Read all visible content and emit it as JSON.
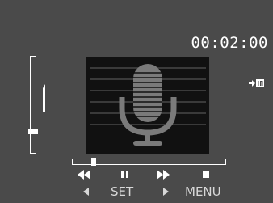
{
  "timer": {
    "elapsed": "00:02:00"
  },
  "volume": {
    "level": 0.22
  },
  "progress": {
    "fraction": 0.12
  },
  "controls": {
    "rewind_icon": "rewind-icon",
    "pause_icon": "pause-icon",
    "fast_forward_icon": "fast-forward-icon",
    "stop_icon": "stop-icon"
  },
  "softkeys": {
    "left_label": "SET",
    "right_label": "MENU"
  },
  "indicators": {
    "input_icon": "line-in-icon"
  },
  "colors": {
    "background": "#4a4a4a",
    "foreground": "#ffffff",
    "panel": "#111111"
  }
}
